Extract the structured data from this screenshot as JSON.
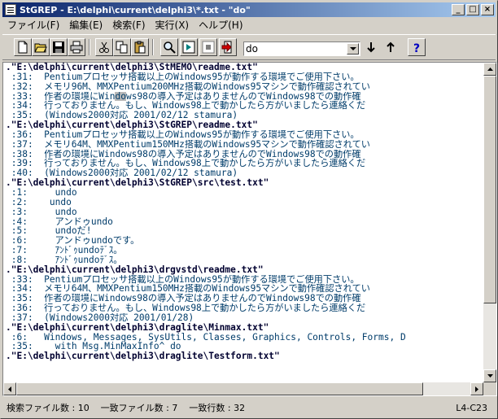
{
  "window": {
    "title": "StGREP - E:\\delphi\\current\\delphi3\\*.txt - \"do\""
  },
  "menu": [
    "ファイル(F)",
    "編集(E)",
    "検索(F)",
    "実行(X)",
    "ヘルプ(H)"
  ],
  "toolbar": {
    "icons": [
      "new-file-icon",
      "open-folder-icon",
      "save-icon",
      "print-icon",
      "cut-icon",
      "copy-icon",
      "paste-icon",
      "search-icon",
      "run-icon",
      "stop-icon",
      "jump-to-file-icon",
      "arrow-down-icon",
      "arrow-up-icon",
      "help-icon"
    ],
    "search_value": "do"
  },
  "results": [
    {
      "type": "file",
      "text": ".\"E:\\delphi\\current\\delphi3\\StMEMO\\readme.txt\""
    },
    {
      "type": "line",
      "text": " :31:  Pentiumプロセッサ搭載以上のWindows95が動作する環境でご使用下さい。"
    },
    {
      "type": "line",
      "text": " :32:  メモリ96M、MMXPentium200MHz搭載のWindows95マシンで動作確認されてい"
    },
    {
      "type": "line",
      "pre": " :33:  作者の環境にWin",
      "hl": "do",
      "post": "ws98の導入予定はありませんのでWindows98での動作確"
    },
    {
      "type": "line",
      "text": " :34:  行っておりません。もし、Windows98上で動かしたら方がいましたら連絡くだ"
    },
    {
      "type": "line",
      "text": " :35:  (Windows2000対応 2001/02/12 stamura)"
    },
    {
      "type": "file",
      "text": ".\"E:\\delphi\\current\\delphi3\\StGREP\\readme.txt\""
    },
    {
      "type": "line",
      "text": " :36:  Pentiumプロセッサ搭載以上のWindows95が動作する環境でご使用下さい。"
    },
    {
      "type": "line",
      "text": " :37:  メモリ64M、MMXPentium150MHz搭載のWindows95マシンで動作確認されてい"
    },
    {
      "type": "line",
      "text": " :38:  作者の環境にWindows98の導入予定はありませんのでWindows98での動作確"
    },
    {
      "type": "line",
      "text": " :39:  行っておりません。もし、Windows98上で動かしたら方がいましたら連絡くだ"
    },
    {
      "type": "line",
      "text": " :40:  (Windows2000対応 2001/02/12 stamura)"
    },
    {
      "type": "file",
      "text": ".\"E:\\delphi\\current\\delphi3\\StGREP\\src\\test.txt\""
    },
    {
      "type": "line",
      "text": " :1:     undo"
    },
    {
      "type": "line",
      "text": " :2:    undo"
    },
    {
      "type": "line",
      "text": " :3:     undo"
    },
    {
      "type": "line",
      "text": " :4:     アンドゥundo"
    },
    {
      "type": "line",
      "text": " :5:     undoだ!"
    },
    {
      "type": "line",
      "text": " :6:     アンドゥundoです。"
    },
    {
      "type": "line",
      "text": " :7:     ｱﾝﾄﾞｩundoﾃﾞｽ。"
    },
    {
      "type": "line",
      "text": " :8:     ｱﾝﾄﾞｩundoﾃﾞｽ。"
    },
    {
      "type": "file",
      "text": ".\"E:\\delphi\\current\\delphi3\\drgvstd\\readme.txt\""
    },
    {
      "type": "line",
      "text": " :33:  Pentiumプロセッサ搭載以上のWindows95が動作する環境でご使用下さい。"
    },
    {
      "type": "line",
      "text": " :34:  メモリ64M、MMXPentium150MHz搭載のWindows95マシンで動作確認されてい"
    },
    {
      "type": "line",
      "text": " :35:  作者の環境にWindows98の導入予定はありませんのでWindows98での動作確"
    },
    {
      "type": "line",
      "text": " :36:  行っておりません。もし、Windows98上で動かしたら方がいましたら連絡くだ"
    },
    {
      "type": "line",
      "text": " :37:  (Windows2000対応 2001/01/28)"
    },
    {
      "type": "file",
      "text": ".\"E:\\delphi\\current\\delphi3\\draglite\\Minmax.txt\""
    },
    {
      "type": "line",
      "text": " :6:   Windows, Messages, SysUtils, Classes, Graphics, Controls, Forms, D"
    },
    {
      "type": "line",
      "text": " :35:    with Msg.MinMaxInfo^ do"
    },
    {
      "type": "file",
      "text": ".\"E:\\delphi\\current\\delphi3\\draglite\\Testform.txt\""
    }
  ],
  "status": {
    "text": "検索ファイル数 : 10    一致ファイル数 : 7    一致行数 : 32",
    "position": "L4-C23"
  }
}
